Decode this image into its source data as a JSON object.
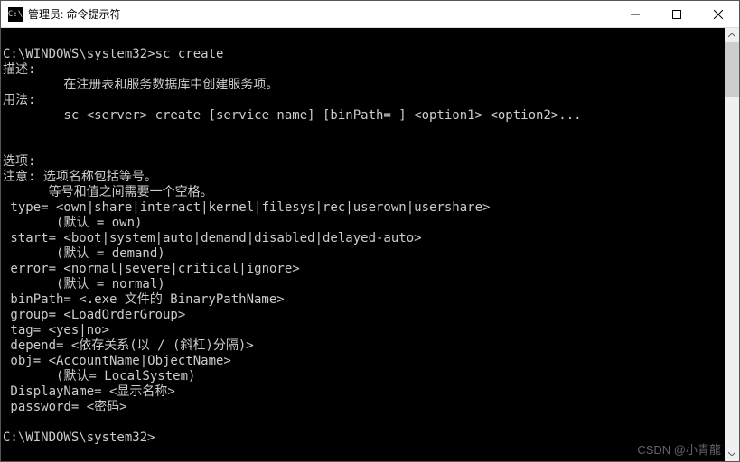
{
  "titlebar": {
    "icon_label": "C:\\",
    "title": "管理员: 命令提示符"
  },
  "terminal": {
    "lines": [
      "",
      "C:\\WINDOWS\\system32>sc create",
      "描述:",
      "        在注册表和服务数据库中创建服务项。",
      "用法:",
      "        sc <server> create [service name] [binPath= ] <option1> <option2>...",
      "",
      "",
      "选项:",
      "注意: 选项名称包括等号。",
      "      等号和值之间需要一个空格。",
      " type= <own|share|interact|kernel|filesys|rec|userown|usershare>",
      "       (默认 = own)",
      " start= <boot|system|auto|demand|disabled|delayed-auto>",
      "       (默认 = demand)",
      " error= <normal|severe|critical|ignore>",
      "       (默认 = normal)",
      " binPath= <.exe 文件的 BinaryPathName>",
      " group= <LoadOrderGroup>",
      " tag= <yes|no>",
      " depend= <依存关系(以 / (斜杠)分隔)>",
      " obj= <AccountName|ObjectName>",
      "       (默认= LocalSystem)",
      " DisplayName= <显示名称>",
      " password= <密码>",
      "",
      "C:\\WINDOWS\\system32>"
    ]
  },
  "watermark": "CSDN @小青龍"
}
